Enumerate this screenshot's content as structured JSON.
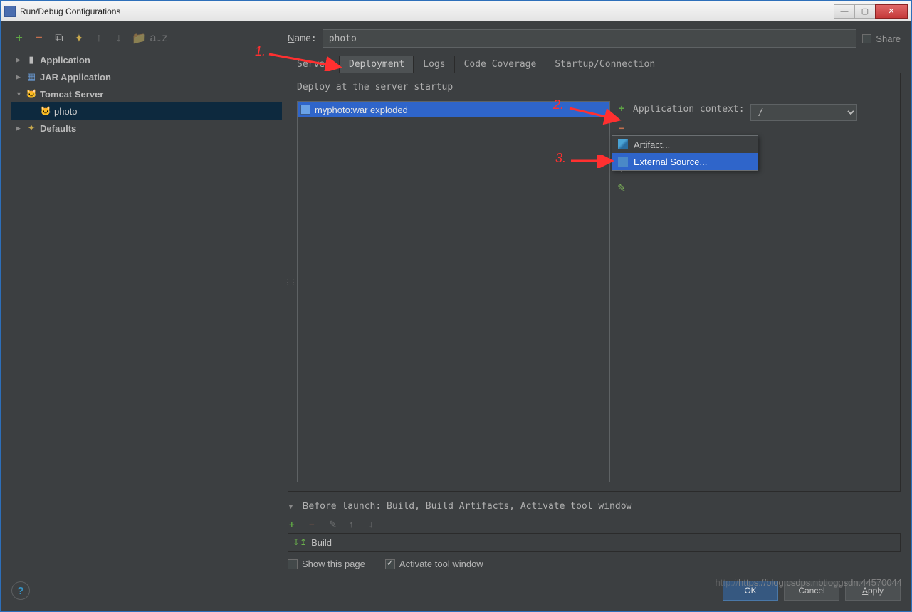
{
  "window": {
    "title": "Run/Debug Configurations"
  },
  "tree": {
    "items": [
      {
        "label": "Application",
        "expandable": true
      },
      {
        "label": "JAR Application",
        "expandable": true
      },
      {
        "label": "Tomcat Server",
        "expandable": true,
        "expanded": true
      },
      {
        "label": "photo",
        "indent": 1,
        "selected": true
      },
      {
        "label": "Defaults",
        "expandable": true
      }
    ]
  },
  "name": {
    "label": "Name:",
    "value": "photo",
    "share": "Share"
  },
  "tabs": [
    "Server",
    "Deployment",
    "Logs",
    "Code Coverage",
    "Startup/Connection"
  ],
  "active_tab": "Deployment",
  "deploy": {
    "title": "Deploy at the server startup",
    "items": [
      "myphoto:war exploded"
    ],
    "context_label": "Application context:",
    "context_value": "/"
  },
  "popup": {
    "items": [
      "Artifact...",
      "External Source..."
    ]
  },
  "before": {
    "title": "Before launch: Build, Build Artifacts, Activate tool window",
    "item": "Build"
  },
  "checks": {
    "show": "Show this page",
    "activate": "Activate tool window"
  },
  "buttons": {
    "ok": "OK",
    "cancel": "Cancel",
    "apply": "Apply"
  },
  "annotations": {
    "n1": "1.",
    "n2": "2.",
    "n3": "3."
  },
  "watermark": {
    "faint": "http://",
    "main": "https://blog.csdps.nbtloggsdn.44570044"
  }
}
